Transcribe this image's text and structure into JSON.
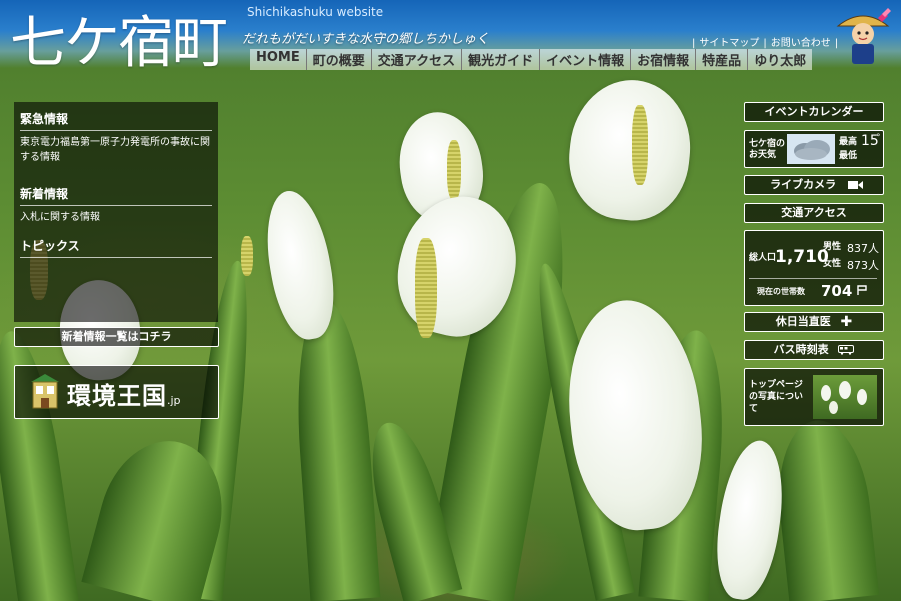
{
  "header": {
    "logo": "七ケ宿町",
    "site_name_en": "Shichikashuku website",
    "tagline": "だれもがだいすきな水守の郷しちかしゅく",
    "utility_links": [
      "サイトマップ",
      "お問い合わせ"
    ],
    "nav": [
      "HOME",
      "町の概要",
      "交通アクセス",
      "観光ガイド",
      "イベント情報",
      "お宿情報",
      "特産品",
      "ゆり太郎"
    ]
  },
  "left": {
    "emergency_title": "緊急情報",
    "emergency_text": "東京電力福島第一原子力発電所の事故に関する情報",
    "news_title": "新着情報",
    "news_text": "入札に関する情報",
    "topics_title": "トピックス",
    "news_list_button": "新着情報一覧はコチラ",
    "banner_text": "環境王国",
    "banner_suffix": ".jp"
  },
  "right": {
    "event_calendar": "イベントカレンダー",
    "weather_label": "七ケ宿の\nお天気",
    "weather_high_label": "最高",
    "weather_low_label": "最低",
    "weather_high_value": "15",
    "weather_unit": "°",
    "live_camera": "ライブカメラ",
    "traffic_access": "交通アクセス",
    "population_label": "総人口",
    "population_total": "1,710",
    "male_label": "男性",
    "male_count": "837人",
    "female_label": "女性",
    "female_count": "873人",
    "households_label": "現在の世帯数",
    "households_count": "704",
    "holiday_doctor": "休日当直医",
    "bus_timetable": "バス時刻表",
    "top_photo_text": "トップページの写真について"
  },
  "colors": {
    "header_blue": "#1565b8",
    "panel_bg": "rgba(0,0,0,0.6)"
  }
}
